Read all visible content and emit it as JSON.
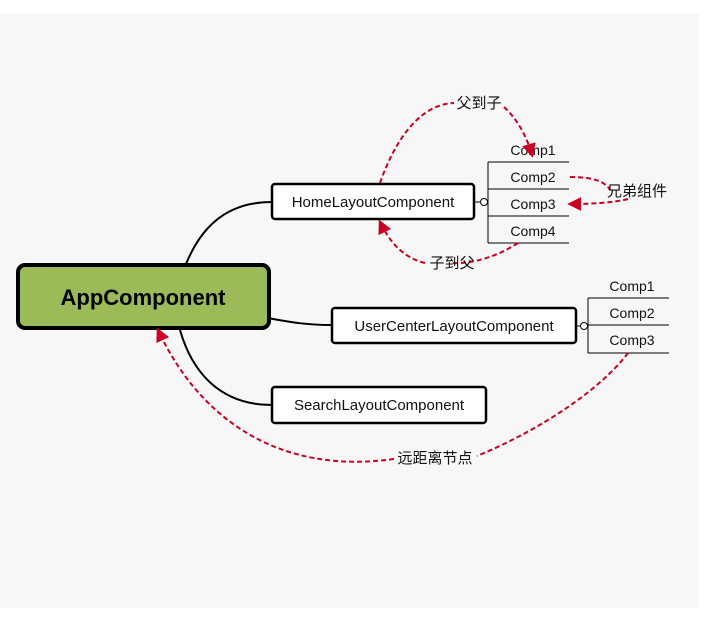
{
  "root": {
    "label": "AppComponent",
    "fill": "#9bbb59"
  },
  "branches": [
    {
      "label": "HomeLayoutComponent",
      "children": [
        "Comp1",
        "Comp2",
        "Comp3",
        "Comp4"
      ]
    },
    {
      "label": "UserCenterLayoutComponent",
      "children": [
        "Comp1",
        "Comp2",
        "Comp3"
      ]
    },
    {
      "label": "SearchLayoutComponent",
      "children": []
    }
  ],
  "relations": {
    "parent_to_child": "父到子",
    "child_to_parent": "子到父",
    "siblings": "兄弟组件",
    "distant": "远距离节点"
  },
  "colors": {
    "arrow": "#cc0022",
    "panel": "#f7f7f7",
    "line": "#000000"
  }
}
